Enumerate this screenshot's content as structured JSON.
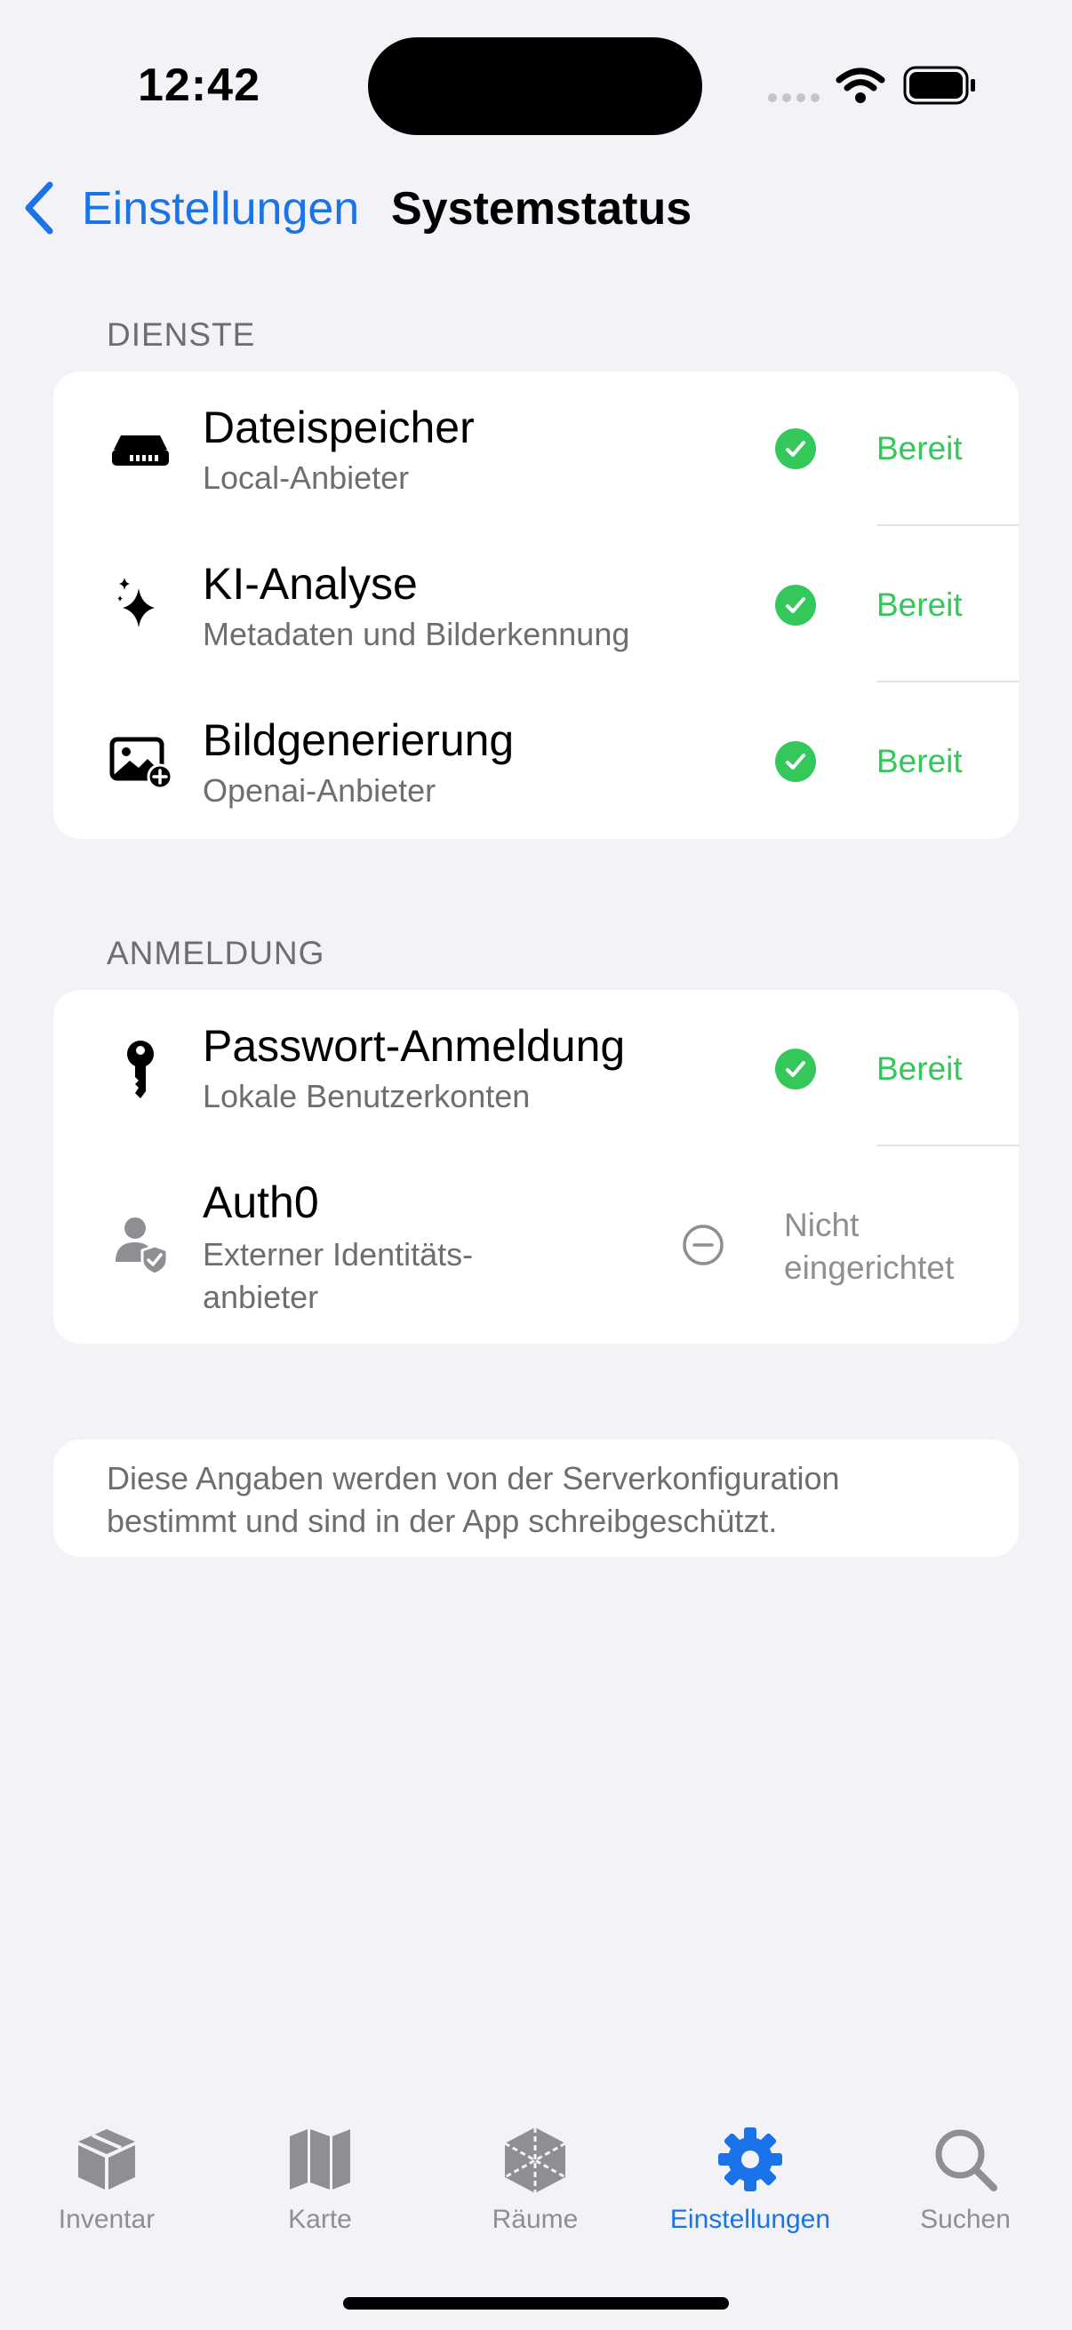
{
  "status_bar": {
    "time": "12:42"
  },
  "nav": {
    "back_label": "Einstellungen",
    "title": "Systemstatus"
  },
  "sections": {
    "services": {
      "header": "DIENSTE",
      "rows": [
        {
          "title": "Dateispeicher",
          "subtitle": "Local-Anbieter",
          "icon": "storage-drive-icon",
          "status": "Bereit"
        },
        {
          "title": "KI-Analyse",
          "subtitle": "Metadaten und Bilderkennung",
          "icon": "sparkles-icon",
          "status": "Bereit"
        },
        {
          "title": "Bildgenerierung",
          "subtitle": "Openai-Anbieter",
          "icon": "photo-add-icon",
          "status": "Bereit"
        }
      ]
    },
    "login": {
      "header": "ANMELDUNG",
      "rows": [
        {
          "title": "Passwort-Anmeldung",
          "subtitle": "Lokale Benutzerkonten",
          "icon": "key-icon",
          "status": "Bereit"
        },
        {
          "title": "Auth0",
          "subtitle_line1": "Externer Identitäts-",
          "subtitle_line2": "anbieter",
          "icon": "person-shield-icon",
          "status_line1": "Nicht",
          "status_line2": "eingerichtet"
        }
      ]
    }
  },
  "footer_note": {
    "line1": "Diese Angaben werden von der Serverkonfiguration",
    "line2": "bestimmt und sind in der App schreibgeschützt."
  },
  "tab_bar": {
    "items": [
      {
        "label": "Inventar",
        "icon": "box-icon"
      },
      {
        "label": "Karte",
        "icon": "map-icon"
      },
      {
        "label": "Räume",
        "icon": "room-cube-icon"
      },
      {
        "label": "Einstellungen",
        "icon": "gear-icon",
        "active": true
      },
      {
        "label": "Suchen",
        "icon": "search-icon"
      }
    ]
  },
  "colors": {
    "accent": "#1a73e8",
    "ready": "#34c759",
    "secondary": "#6d6d72",
    "background": "#f2f2f7"
  }
}
